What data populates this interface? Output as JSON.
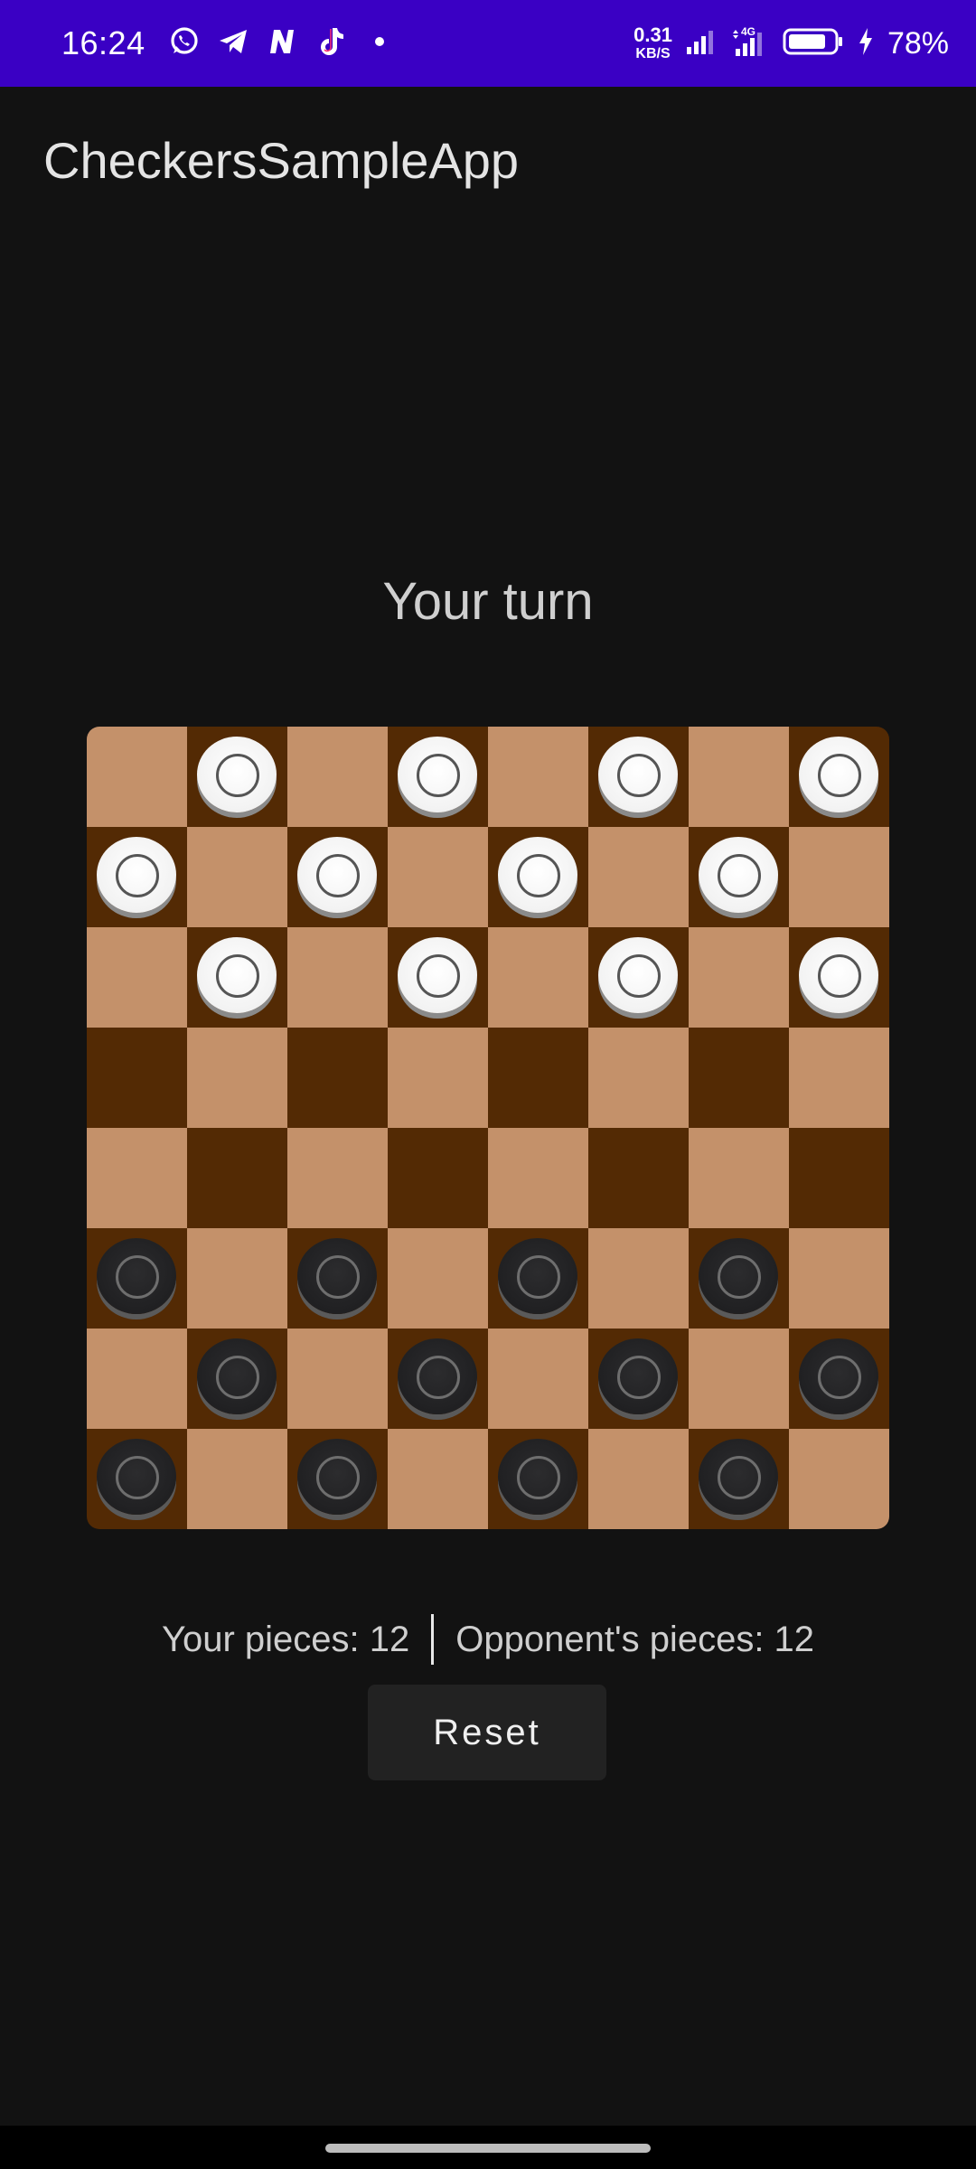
{
  "status_bar": {
    "time": "16:24",
    "net_speed_value": "0.31",
    "net_speed_unit": "KB/S",
    "network_type": "4G",
    "battery_percent": "78%",
    "left_icons": [
      "whatsapp-icon",
      "telegram-icon",
      "n-app-icon",
      "tiktok-icon",
      "notification-dot-icon"
    ],
    "right_icons": [
      "signal-icon",
      "signal-4g-icon",
      "battery-icon",
      "charging-bolt-icon"
    ]
  },
  "app": {
    "title": "CheckersSampleApp"
  },
  "game": {
    "turn_text": "Your turn",
    "board": {
      "size": 8,
      "light_color": "#c4916a",
      "dark_color": "#532a04",
      "rows": [
        "-w-w-w-w",
        "w-w-w-w-",
        "-w-w-w-w",
        "--------",
        "--------",
        "b-b-b-b-",
        "-b-b-b-b",
        "b-b-b-b-"
      ]
    },
    "your_pieces_text": "Your pieces: 12",
    "opponent_pieces_text": "Opponent's pieces: 12",
    "reset_label": "Reset"
  },
  "colors": {
    "status_bar": "#3a00c4",
    "background": "#121212",
    "white_piece": "#f2f2f2",
    "black_piece": "#1e1e20"
  }
}
